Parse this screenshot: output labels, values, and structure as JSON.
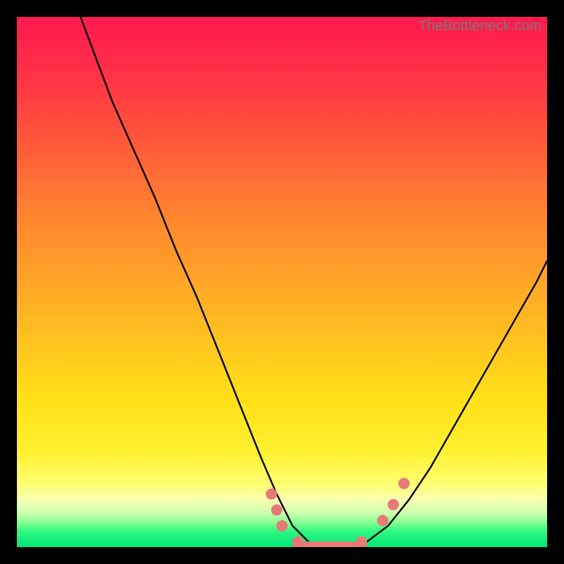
{
  "watermark": "TheBottleneck.com",
  "chart_data": {
    "type": "line",
    "title": "",
    "xlabel": "",
    "ylabel": "",
    "xlim": [
      0,
      100
    ],
    "ylim": [
      0,
      100
    ],
    "series": [
      {
        "name": "bottleneck-curve",
        "x": [
          12,
          15,
          18,
          22,
          26,
          30,
          34,
          38,
          42,
          46,
          49,
          52,
          55,
          58,
          62,
          66,
          70,
          74,
          78,
          82,
          86,
          90,
          94,
          98,
          100
        ],
        "y": [
          100,
          92,
          84,
          75,
          66,
          56,
          47,
          37,
          27,
          17,
          10,
          4,
          1,
          0,
          0,
          1,
          4,
          9,
          15,
          22,
          29,
          36,
          43,
          50,
          54
        ]
      }
    ],
    "markers": [
      {
        "name": "left-cluster-1",
        "x": 48,
        "y": 10
      },
      {
        "name": "left-cluster-2",
        "x": 49,
        "y": 7
      },
      {
        "name": "left-cluster-3",
        "x": 50,
        "y": 4
      },
      {
        "name": "trough-1",
        "x": 53,
        "y": 1
      },
      {
        "name": "trough-2",
        "x": 56,
        "y": 0
      },
      {
        "name": "trough-3",
        "x": 59,
        "y": 0
      },
      {
        "name": "trough-4",
        "x": 62,
        "y": 0
      },
      {
        "name": "trough-5",
        "x": 65,
        "y": 1
      },
      {
        "name": "right-cluster-1",
        "x": 69,
        "y": 5
      },
      {
        "name": "right-cluster-2",
        "x": 71,
        "y": 8
      },
      {
        "name": "right-cluster-3",
        "x": 73,
        "y": 12
      }
    ],
    "gradient_stops": [
      {
        "pct": 0,
        "color": "#ff1a4d"
      },
      {
        "pct": 50,
        "color": "#ffb020"
      },
      {
        "pct": 88,
        "color": "#ffff70"
      },
      {
        "pct": 100,
        "color": "#00e878"
      }
    ]
  }
}
